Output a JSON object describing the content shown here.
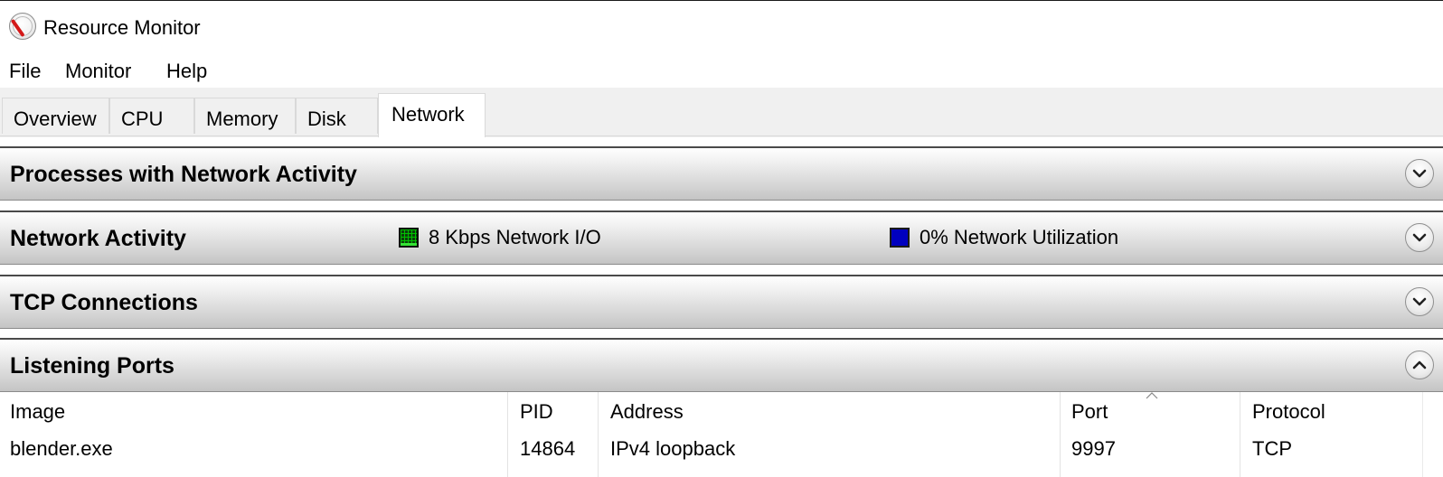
{
  "window": {
    "title": "Resource Monitor",
    "icon": "resource-monitor-icon"
  },
  "menu": [
    "File",
    "Monitor",
    "Help"
  ],
  "tabs": [
    "Overview",
    "CPU",
    "Memory",
    "Disk",
    "Network"
  ],
  "active_tab": "Network",
  "sections": [
    {
      "title": "Processes with Network Activity",
      "expanded": false,
      "toggle_icon": "chevron-down-icon"
    },
    {
      "title": "Network Activity",
      "expanded": false,
      "toggle_icon": "chevron-down-icon",
      "legend": [
        {
          "label": "8 Kbps Network I/O",
          "color": "#00c000"
        },
        {
          "label": "0% Network Utilization",
          "color": "#0000bf"
        }
      ]
    },
    {
      "title": "TCP Connections",
      "expanded": false,
      "toggle_icon": "chevron-down-icon"
    },
    {
      "title": "Listening Ports",
      "expanded": true,
      "toggle_icon": "chevron-up-icon"
    }
  ],
  "listening_ports": {
    "columns": [
      "Image",
      "PID",
      "Address",
      "Port",
      "Protocol"
    ],
    "sorted_column": "Port",
    "rows": [
      {
        "image": "blender.exe",
        "pid": "14864",
        "address": "IPv4 loopback",
        "port": "9997",
        "protocol": "TCP"
      }
    ]
  }
}
